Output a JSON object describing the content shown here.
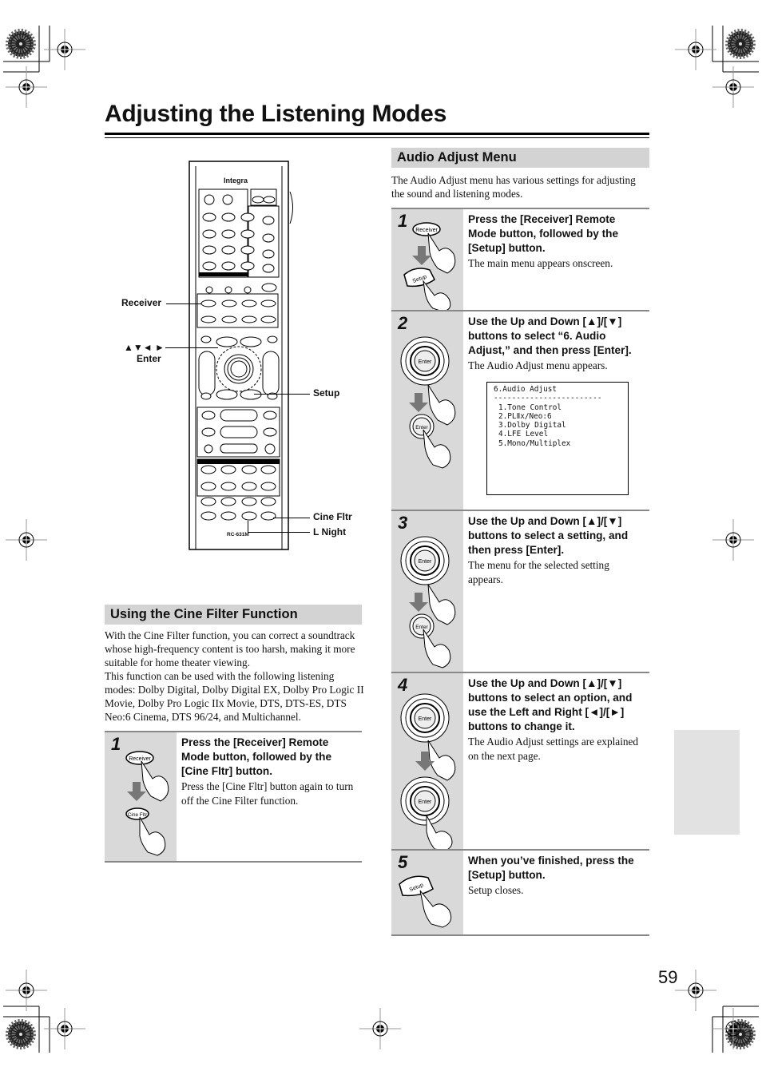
{
  "page": {
    "title": "Adjusting the Listening Modes",
    "page_number": "59"
  },
  "remote": {
    "brand": "Integra",
    "model": "RC-631M",
    "callouts": {
      "receiver": "Receiver",
      "arrows": "▲▼◄ ►",
      "enter": "Enter",
      "setup": "Setup",
      "cine_fltr": "Cine Fltr",
      "l_night": "L Night"
    }
  },
  "cine_filter": {
    "heading": "Using the Cine Filter Function",
    "paragraphs": [
      "With the Cine Filter function, you can correct a soundtrack whose high-frequency content is too harsh, making it more suitable for home theater viewing.",
      "This function can be used with the following listening modes: Dolby Digital, Dolby Digital EX, Dolby Pro Logic II Movie, Dolby Pro Logic IIx Movie, DTS, DTS-ES, DTS Neo:6 Cinema, DTS 96/24, and Multichannel."
    ],
    "steps": [
      {
        "number": "1",
        "instruction": "Press the [Receiver] Remote Mode button, followed by the [Cine Fltr] button.",
        "note": "Press the [Cine Fltr] button again to turn off the Cine Filter function.",
        "buttons": [
          "Receiver",
          "Cine Fltr"
        ]
      }
    ]
  },
  "audio_adjust": {
    "heading": "Audio Adjust Menu",
    "intro": "The Audio Adjust menu has various settings for adjusting the sound and listening modes.",
    "steps": [
      {
        "number": "1",
        "instruction": "Press the [Receiver] Remote Mode button, followed by the [Setup] button.",
        "note": "The main menu appears onscreen.",
        "buttons": [
          "Receiver",
          "Setup"
        ]
      },
      {
        "number": "2",
        "instruction": "Use the Up and Down [▲]/[▼] buttons to select “6. Audio Adjust,” and then press [Enter].",
        "note": "The Audio Adjust menu appears.",
        "buttons": [
          "Enter",
          "Enter"
        ]
      },
      {
        "number": "3",
        "instruction": "Use the Up and Down [▲]/[▼] buttons to select a setting, and then press [Enter].",
        "note": "The menu for the selected setting appears.",
        "buttons": [
          "Enter",
          "Enter"
        ]
      },
      {
        "number": "4",
        "instruction": "Use the Up and Down [▲]/[▼] buttons to select an option, and use the Left and Right [◄]/[►] buttons to change it.",
        "note": "The Audio Adjust settings are explained on the next page.",
        "buttons": [
          "Enter",
          "Enter"
        ]
      },
      {
        "number": "5",
        "instruction": "When you’ve finished, press the [Setup] button.",
        "note": "Setup closes.",
        "buttons": [
          "Setup"
        ]
      }
    ],
    "osd": {
      "title": "6.Audio Adjust",
      "separator": "------------------------",
      "items": [
        "1.Tone Control",
        "2.PLⅡx/Neo:6",
        "3.Dolby Digital",
        "4.LFE Level",
        "5.Mono/Multiplex"
      ]
    }
  },
  "icons": {
    "registration_mark": "crosshair-circle",
    "color_target": "radial-starburst",
    "hand_press": "pointing-hand",
    "arrow_down": "down-arrow"
  }
}
